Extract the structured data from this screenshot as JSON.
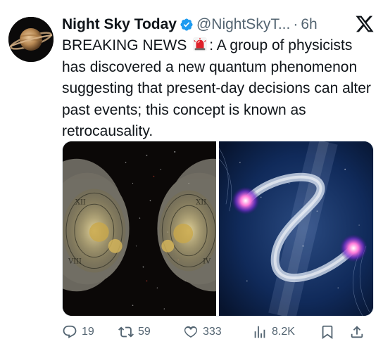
{
  "tweet": {
    "author_name": "Night Sky Today",
    "handle": "@NightSkyT...",
    "separator": "·",
    "time": "6h",
    "text_before_emoji": "BREAKING NEWS",
    "text_after_emoji": ": A group of physicists has discovered a new quantum phenomenon suggesting that present-day decisions can alter past events; this concept is known as retrocausality.",
    "emoji": "siren-icon"
  },
  "actions": {
    "replies": "19",
    "retweets": "59",
    "likes": "333",
    "views": "8.2K"
  },
  "colors": {
    "verified": "#1d9bf0",
    "text": "#0f1419",
    "muted": "#536471"
  }
}
